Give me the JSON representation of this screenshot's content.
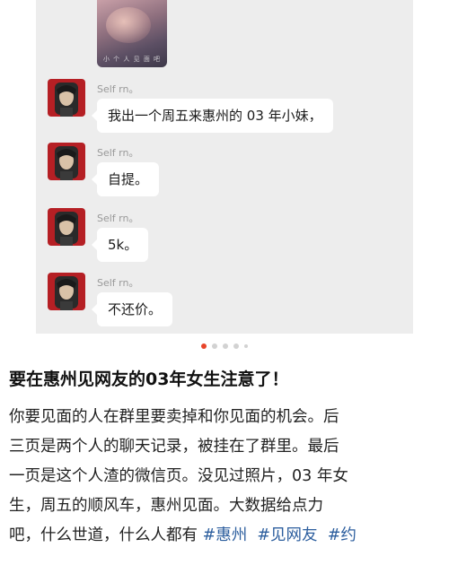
{
  "chat": {
    "photo_caption": "小 个 人 见 面 吧",
    "messages": [
      {
        "sender": "Self rn。",
        "text": "我出一个周五来惠州的 03 年小妹，"
      },
      {
        "sender": "Self rn。",
        "text": "自提。"
      },
      {
        "sender": "Self rn。",
        "text": "5k。"
      },
      {
        "sender": "Self rn。",
        "text": "不还价。"
      }
    ]
  },
  "pager": {
    "count": 5,
    "active_index": 0
  },
  "article": {
    "headline": "要在惠州见网友的03年女生注意了！",
    "lines": [
      "你要见面的人在群里要卖掉和你见面的机会。后",
      "三页是两个人的聊天记录，被挂在了群里。最后",
      "一页是这个人渣的微信页。没见过照片，03 年女",
      "生，周五的顺风车，惠州见面。大数据给点力"
    ],
    "last_line_text": "吧，什么世道，什么人都有 ",
    "tags": [
      "#惠州",
      "#见网友",
      "#约"
    ]
  },
  "colors": {
    "accent": "#e8452a",
    "tag": "#2c5e9e",
    "avatar_bg": "#b51f24"
  }
}
